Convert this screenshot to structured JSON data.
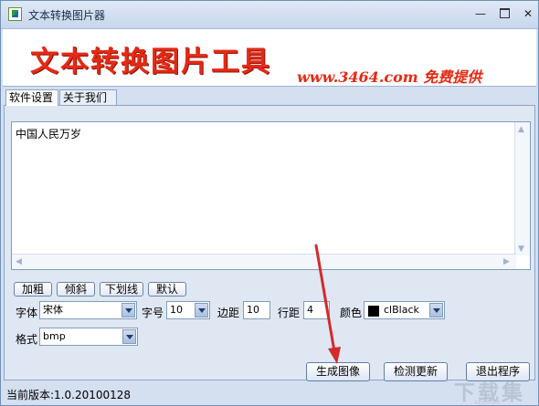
{
  "window": {
    "title": "文本转换图片器"
  },
  "titlebar": {
    "minimize": "—",
    "close": "✕"
  },
  "banner": {
    "title": "文本转换图片工具",
    "subtitle": "www.3464.com 免费提供"
  },
  "tabs": [
    {
      "label": "软件设置"
    },
    {
      "label": "关于我们"
    }
  ],
  "editor": {
    "text": "中国人民万岁"
  },
  "style_buttons": {
    "bold": "加粗",
    "italic": "倾斜",
    "underline": "下划线",
    "default": "默认"
  },
  "settings": {
    "font_label": "字体",
    "font_value": "宋体",
    "size_label": "字号",
    "size_value": "10",
    "margin_label": "边距",
    "margin_value": "10",
    "line_label": "行距",
    "line_value": "4",
    "color_label": "颜色",
    "color_value": "clBlack",
    "format_label": "格式",
    "format_value": "bmp"
  },
  "actions": {
    "generate": "生成图像",
    "check_update": "检测更新",
    "exit": "退出程序"
  },
  "status": {
    "version": "当前版本:1.0.20100128"
  },
  "watermark": {
    "text": "下载集",
    "sub": "xzji.com"
  },
  "colors": {
    "banner_red": "#e52a14",
    "annotation_red": "#d42a2a",
    "swatch": "#000000"
  }
}
